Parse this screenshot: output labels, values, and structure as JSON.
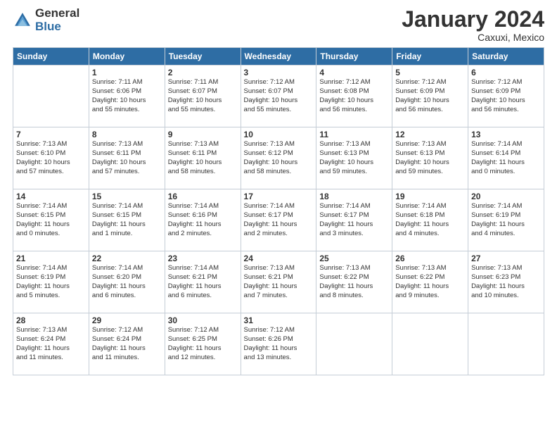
{
  "logo": {
    "general": "General",
    "blue": "Blue"
  },
  "header": {
    "month": "January 2024",
    "location": "Caxuxi, Mexico"
  },
  "weekdays": [
    "Sunday",
    "Monday",
    "Tuesday",
    "Wednesday",
    "Thursday",
    "Friday",
    "Saturday"
  ],
  "weeks": [
    [
      {
        "num": "",
        "info": ""
      },
      {
        "num": "1",
        "info": "Sunrise: 7:11 AM\nSunset: 6:06 PM\nDaylight: 10 hours\nand 55 minutes."
      },
      {
        "num": "2",
        "info": "Sunrise: 7:11 AM\nSunset: 6:07 PM\nDaylight: 10 hours\nand 55 minutes."
      },
      {
        "num": "3",
        "info": "Sunrise: 7:12 AM\nSunset: 6:07 PM\nDaylight: 10 hours\nand 55 minutes."
      },
      {
        "num": "4",
        "info": "Sunrise: 7:12 AM\nSunset: 6:08 PM\nDaylight: 10 hours\nand 56 minutes."
      },
      {
        "num": "5",
        "info": "Sunrise: 7:12 AM\nSunset: 6:09 PM\nDaylight: 10 hours\nand 56 minutes."
      },
      {
        "num": "6",
        "info": "Sunrise: 7:12 AM\nSunset: 6:09 PM\nDaylight: 10 hours\nand 56 minutes."
      }
    ],
    [
      {
        "num": "7",
        "info": "Sunrise: 7:13 AM\nSunset: 6:10 PM\nDaylight: 10 hours\nand 57 minutes."
      },
      {
        "num": "8",
        "info": "Sunrise: 7:13 AM\nSunset: 6:11 PM\nDaylight: 10 hours\nand 57 minutes."
      },
      {
        "num": "9",
        "info": "Sunrise: 7:13 AM\nSunset: 6:11 PM\nDaylight: 10 hours\nand 58 minutes."
      },
      {
        "num": "10",
        "info": "Sunrise: 7:13 AM\nSunset: 6:12 PM\nDaylight: 10 hours\nand 58 minutes."
      },
      {
        "num": "11",
        "info": "Sunrise: 7:13 AM\nSunset: 6:13 PM\nDaylight: 10 hours\nand 59 minutes."
      },
      {
        "num": "12",
        "info": "Sunrise: 7:13 AM\nSunset: 6:13 PM\nDaylight: 10 hours\nand 59 minutes."
      },
      {
        "num": "13",
        "info": "Sunrise: 7:14 AM\nSunset: 6:14 PM\nDaylight: 11 hours\nand 0 minutes."
      }
    ],
    [
      {
        "num": "14",
        "info": "Sunrise: 7:14 AM\nSunset: 6:15 PM\nDaylight: 11 hours\nand 0 minutes."
      },
      {
        "num": "15",
        "info": "Sunrise: 7:14 AM\nSunset: 6:15 PM\nDaylight: 11 hours\nand 1 minute."
      },
      {
        "num": "16",
        "info": "Sunrise: 7:14 AM\nSunset: 6:16 PM\nDaylight: 11 hours\nand 2 minutes."
      },
      {
        "num": "17",
        "info": "Sunrise: 7:14 AM\nSunset: 6:17 PM\nDaylight: 11 hours\nand 2 minutes."
      },
      {
        "num": "18",
        "info": "Sunrise: 7:14 AM\nSunset: 6:17 PM\nDaylight: 11 hours\nand 3 minutes."
      },
      {
        "num": "19",
        "info": "Sunrise: 7:14 AM\nSunset: 6:18 PM\nDaylight: 11 hours\nand 4 minutes."
      },
      {
        "num": "20",
        "info": "Sunrise: 7:14 AM\nSunset: 6:19 PM\nDaylight: 11 hours\nand 4 minutes."
      }
    ],
    [
      {
        "num": "21",
        "info": "Sunrise: 7:14 AM\nSunset: 6:19 PM\nDaylight: 11 hours\nand 5 minutes."
      },
      {
        "num": "22",
        "info": "Sunrise: 7:14 AM\nSunset: 6:20 PM\nDaylight: 11 hours\nand 6 minutes."
      },
      {
        "num": "23",
        "info": "Sunrise: 7:14 AM\nSunset: 6:21 PM\nDaylight: 11 hours\nand 6 minutes."
      },
      {
        "num": "24",
        "info": "Sunrise: 7:13 AM\nSunset: 6:21 PM\nDaylight: 11 hours\nand 7 minutes."
      },
      {
        "num": "25",
        "info": "Sunrise: 7:13 AM\nSunset: 6:22 PM\nDaylight: 11 hours\nand 8 minutes."
      },
      {
        "num": "26",
        "info": "Sunrise: 7:13 AM\nSunset: 6:22 PM\nDaylight: 11 hours\nand 9 minutes."
      },
      {
        "num": "27",
        "info": "Sunrise: 7:13 AM\nSunset: 6:23 PM\nDaylight: 11 hours\nand 10 minutes."
      }
    ],
    [
      {
        "num": "28",
        "info": "Sunrise: 7:13 AM\nSunset: 6:24 PM\nDaylight: 11 hours\nand 11 minutes."
      },
      {
        "num": "29",
        "info": "Sunrise: 7:12 AM\nSunset: 6:24 PM\nDaylight: 11 hours\nand 11 minutes."
      },
      {
        "num": "30",
        "info": "Sunrise: 7:12 AM\nSunset: 6:25 PM\nDaylight: 11 hours\nand 12 minutes."
      },
      {
        "num": "31",
        "info": "Sunrise: 7:12 AM\nSunset: 6:26 PM\nDaylight: 11 hours\nand 13 minutes."
      },
      {
        "num": "",
        "info": ""
      },
      {
        "num": "",
        "info": ""
      },
      {
        "num": "",
        "info": ""
      }
    ]
  ]
}
